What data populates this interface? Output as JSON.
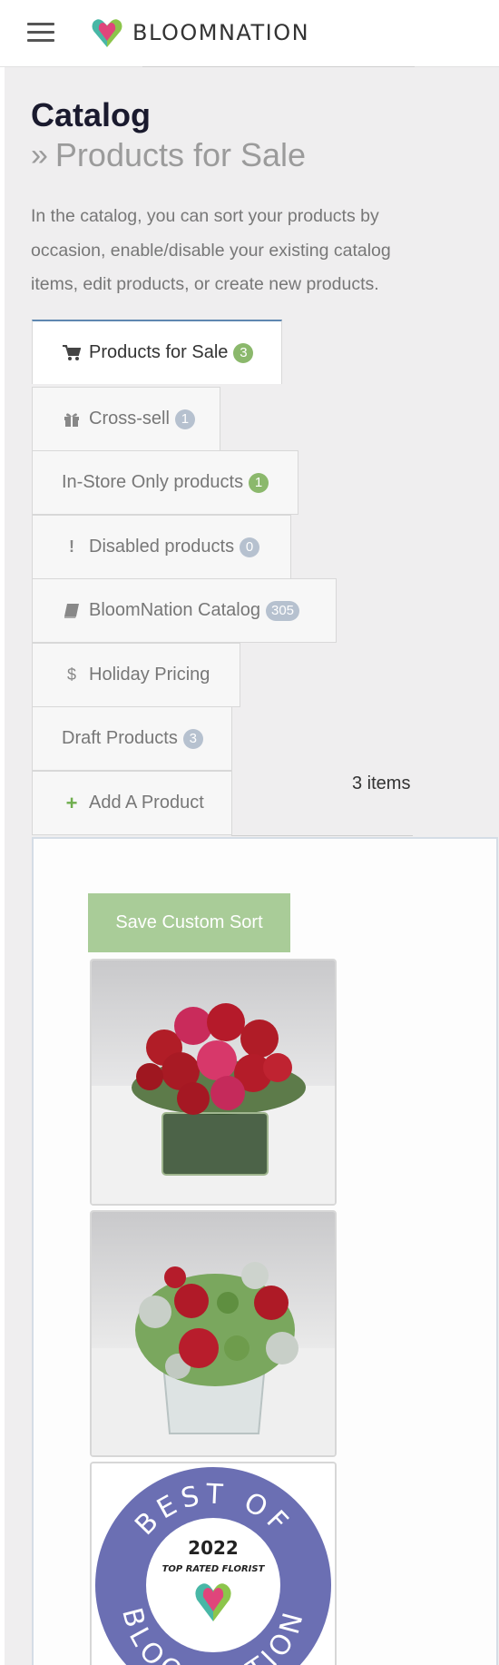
{
  "header": {
    "brand": "BLOOMNATION",
    "menu_icon": "hamburger-icon",
    "logo_icon": "heart-logo-icon"
  },
  "page": {
    "title": "Catalog",
    "subtitle": "Products for Sale",
    "description": "In the catalog, you can sort your products by occasion, enable/disable your existing catalog items, edit products, or create new products."
  },
  "tabs": [
    {
      "label": "Products for Sale",
      "badge": "3",
      "badge_color": "green",
      "icon": "cart-icon",
      "active": true
    },
    {
      "label": "Cross-sell",
      "badge": "1",
      "badge_color": "gray",
      "icon": "gift-icon"
    },
    {
      "label": "In-Store Only products",
      "badge": "1",
      "badge_color": "green",
      "icon": ""
    },
    {
      "label": "Disabled products",
      "badge": "0",
      "badge_color": "gray",
      "icon": "exclamation-icon"
    },
    {
      "label": "BloomNation Catalog",
      "badge": "305",
      "badge_color": "gray",
      "icon": "book-icon"
    },
    {
      "label": "Holiday Pricing",
      "badge": "",
      "icon": "dollar-icon"
    },
    {
      "label": "Draft Products",
      "badge": "3",
      "badge_color": "gray",
      "icon": ""
    },
    {
      "label": "Add A Product",
      "badge": "",
      "icon": "plus-icon"
    }
  ],
  "items_count": "3 items",
  "save_button": "Save Custom Sort",
  "products": [
    {
      "image": "red-roses-cube-arrangement"
    },
    {
      "image": "red-roses-dusty-miller-arrangement"
    },
    {
      "image": "best-of-bloomnation-badge"
    }
  ],
  "badge_art": {
    "top": "BEST OF",
    "year": "2022",
    "tagline": "TOP RATED FLORIST",
    "bottom": "BLOOMNATION"
  },
  "colors": {
    "accent_green": "#8bb86c",
    "button_green": "#a9cc98",
    "active_tab_border": "#5e87b0",
    "badge_purple": "#6b6fb3"
  }
}
